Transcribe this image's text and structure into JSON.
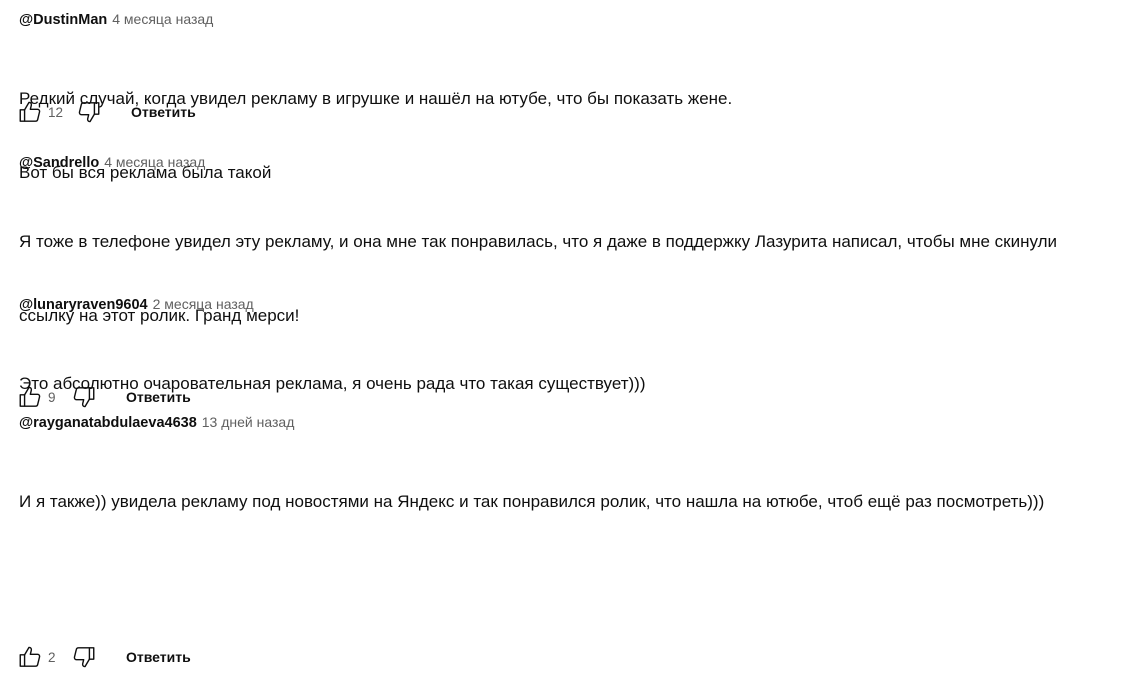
{
  "comments": [
    {
      "author": "@DustinMan",
      "time": "4 месяца назад",
      "lines": [
        "Редкий случай, когда увидел рекламу в игрушке и нашёл на ютубе, что бы показать жене.",
        "Вот бы вся реклама была такой"
      ],
      "likes": "12",
      "reply_label": "Ответить"
    },
    {
      "author": "@Sandrello",
      "time": "4 месяца назад",
      "lines": [
        "Я тоже в телефоне увидел эту рекламу, и она мне так понравилась, что я даже в поддержку Лазурита написал, чтобы мне скинули",
        "ссылку на этот ролик. Гранд мерси!"
      ],
      "likes": "9",
      "reply_label": "Ответить"
    },
    {
      "author": "@lunaryraven9604",
      "time": "2 месяца назад",
      "lines": [
        "Это абсолютно очаровательная реклама, я очень рада что такая существует)))"
      ],
      "likes": "2",
      "reply_label": "Ответить"
    },
    {
      "author": "@rayganatabdulaeva4638",
      "time": "13 дней назад",
      "lines": [
        "И я также)) увидела рекламу под новостями на Яндекс и так понравился ролик, что нашла на ютюбе, чтоб ещё раз посмотреть)))"
      ]
    }
  ],
  "icons": {
    "like": "thumb-up-icon",
    "dislike": "thumb-down-icon"
  },
  "colors": {
    "text": "#0f0f0f",
    "secondary": "#606060",
    "background": "#ffffff"
  }
}
